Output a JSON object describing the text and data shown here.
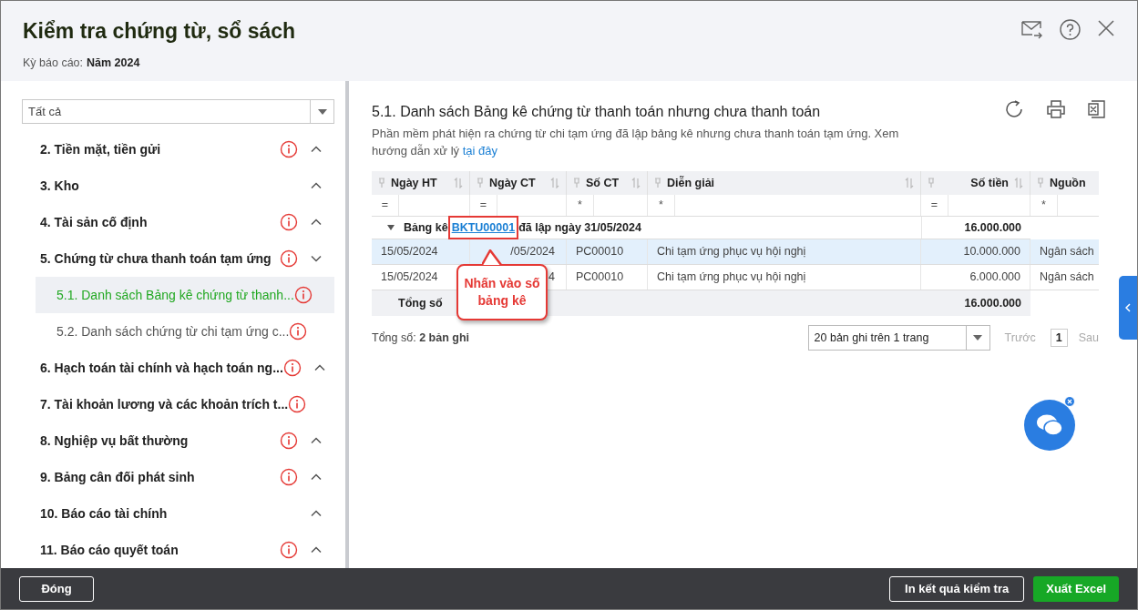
{
  "header": {
    "title": "Kiểm tra chứng từ, sổ sách",
    "period_label": "Kỳ báo cáo:",
    "period_value": "Năm 2024"
  },
  "sidebar": {
    "filter": {
      "value": "Tất cả"
    },
    "items": [
      {
        "label": "2. Tiền mặt, tiền gửi",
        "warning": true,
        "expanded": false,
        "selected": false
      },
      {
        "label": "3. Kho",
        "warning": false,
        "expanded": false,
        "selected": false
      },
      {
        "label": "4. Tài sản cố định",
        "warning": true,
        "expanded": false,
        "selected": false
      },
      {
        "label": "5. Chứng từ chưa thanh toán tạm ứng",
        "warning": true,
        "expanded": true,
        "selected": false,
        "children": [
          {
            "label": "5.1. Danh sách Bảng kê chứng từ thanh...",
            "warning": true,
            "selected": true
          },
          {
            "label": "5.2. Danh sách chứng từ chi tạm ứng c...",
            "warning": true,
            "selected": false
          }
        ]
      },
      {
        "label": "6. Hạch toán tài chính và hạch toán ng...",
        "warning": true,
        "expanded": false,
        "selected": false
      },
      {
        "label": "7. Tài khoản lương và các khoản trích t...",
        "warning": true,
        "selected": false
      },
      {
        "label": "8. Nghiệp vụ bất thường",
        "warning": true,
        "expanded": false,
        "selected": false
      },
      {
        "label": "9. Bảng cân đối phát sinh",
        "warning": true,
        "expanded": false,
        "selected": false
      },
      {
        "label": "10. Báo cáo tài chính",
        "warning": false,
        "expanded": false,
        "selected": false
      },
      {
        "label": "11. Báo cáo quyết toán",
        "warning": true,
        "expanded": false,
        "selected": false
      }
    ]
  },
  "content": {
    "title": "5.1. Danh sách Bảng kê chứng từ thanh toán nhưng chưa thanh toán",
    "description": "Phần mềm phát hiện ra chứng từ chi tạm ứng đã lập bảng kê nhưng chưa thanh toán tạm ứng. Xem hướng dẫn xử lý",
    "link": "tại đây",
    "table": {
      "columns": [
        {
          "label": "Ngày HT",
          "filter": "="
        },
        {
          "label": "Ngày CT",
          "filter": "="
        },
        {
          "label": "Số CT",
          "filter": "*"
        },
        {
          "label": "Diễn giải",
          "filter": "*"
        },
        {
          "label": "Số tiền",
          "filter": "="
        },
        {
          "label": "Nguồn",
          "filter": "*"
        }
      ],
      "group": {
        "prefix": "Bảng kê",
        "link": "BKTU00001",
        "suffix": "đã lập ngày 31/05/2024",
        "amount": "16.000.000"
      },
      "rows": [
        {
          "selected": true,
          "cells": [
            "15/05/2024",
            "/05/2024",
            "PC00010",
            "Chi tạm ứng phục vụ hội nghị",
            "10.000.000",
            "Ngân sách"
          ]
        },
        {
          "selected": false,
          "cells": [
            "15/05/2024",
            "4",
            "PC00010",
            "Chi tạm ứng phục vụ hội nghị",
            "6.000.000",
            "Ngân sách"
          ]
        }
      ],
      "total": {
        "label": "Tổng số",
        "amount": "16.000.000"
      }
    },
    "callout": "Nhấn vào số bảng kê",
    "record_count_label": "Tổng số:",
    "record_count": "2 bản ghi",
    "page_size": "20 bản ghi trên 1 trang",
    "pager": {
      "prev": "Trước",
      "page": "1",
      "next": "Sau"
    }
  },
  "footer": {
    "close": "Đóng",
    "print": "In kết quả kiểm tra",
    "export": "Xuất Excel"
  }
}
